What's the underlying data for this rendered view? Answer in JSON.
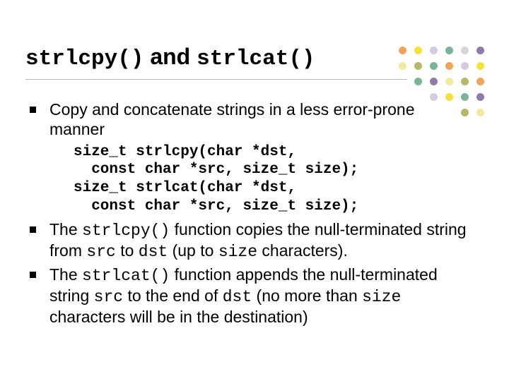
{
  "title": {
    "code1": "strlcpy()",
    "mid": " and ",
    "code2": "strlcat()"
  },
  "bullet1": "Copy and concatenate strings in a less error-prone manner",
  "code": {
    "l1": "size_t strlcpy(char *dst,",
    "l2": "  const char *src, size_t size);",
    "l3": "size_t strlcat(char *dst,",
    "l4": "  const char *src, size_t size);"
  },
  "bullet2": {
    "t1": "The ",
    "c1": "strlcpy()",
    "t2": " function copies the null-terminated string from ",
    "c2": "src",
    "t3": " to ",
    "c3": "dst",
    "t4": " (up to ",
    "c4": "size",
    "t5": " characters)."
  },
  "bullet3": {
    "t1": "The ",
    "c1": "strlcat()",
    "t2": " function appends the null-terminated string ",
    "c2": "src",
    "t3": " to the end of ",
    "c3": "dst",
    "t4": " (no more than ",
    "c4": "size",
    "t5": " characters will be in the destination)"
  }
}
